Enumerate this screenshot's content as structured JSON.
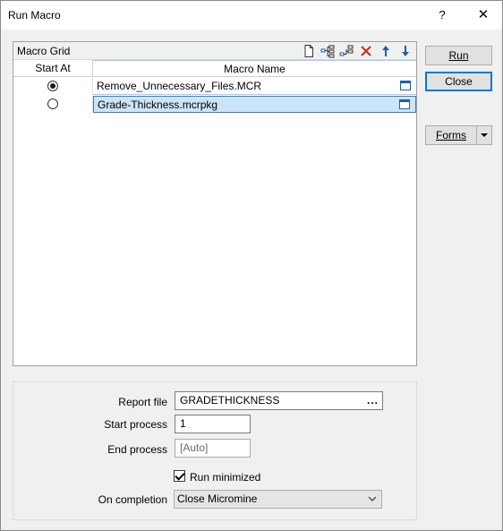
{
  "window": {
    "title": "Run Macro",
    "help_glyph": "?",
    "close_glyph": "✕"
  },
  "grid": {
    "title": "Macro Grid",
    "columns": [
      "Start At",
      "Macro Name"
    ],
    "rows": [
      {
        "start_at": true,
        "name": "Remove_Unnecessary_Files.MCR"
      },
      {
        "start_at": false,
        "name": "Grade-Thickness.mcrpkg"
      }
    ],
    "toolbar": [
      "new-icon",
      "insert-icon",
      "append-icon",
      "delete-icon",
      "move-up-icon",
      "move-down-icon"
    ]
  },
  "buttons": {
    "run_label": "Run",
    "close_label": "Close",
    "forms_label": "Forms"
  },
  "form": {
    "report_file_label": "Report file",
    "report_file_value": "GRADETHICKNESS",
    "browse_label": "...",
    "start_process_label": "Start process",
    "start_process_value": "1",
    "end_process_label": "End process",
    "end_process_value": "[Auto]",
    "run_minimized_label": "Run minimized",
    "run_minimized_checked": true,
    "on_completion_label": "On completion",
    "on_completion_value": "Close Micromine"
  },
  "colors": {
    "selection": "#cce4f7",
    "accent": "#0078d7",
    "delete": "#d9261c",
    "arrow": "#1f5fa8"
  }
}
